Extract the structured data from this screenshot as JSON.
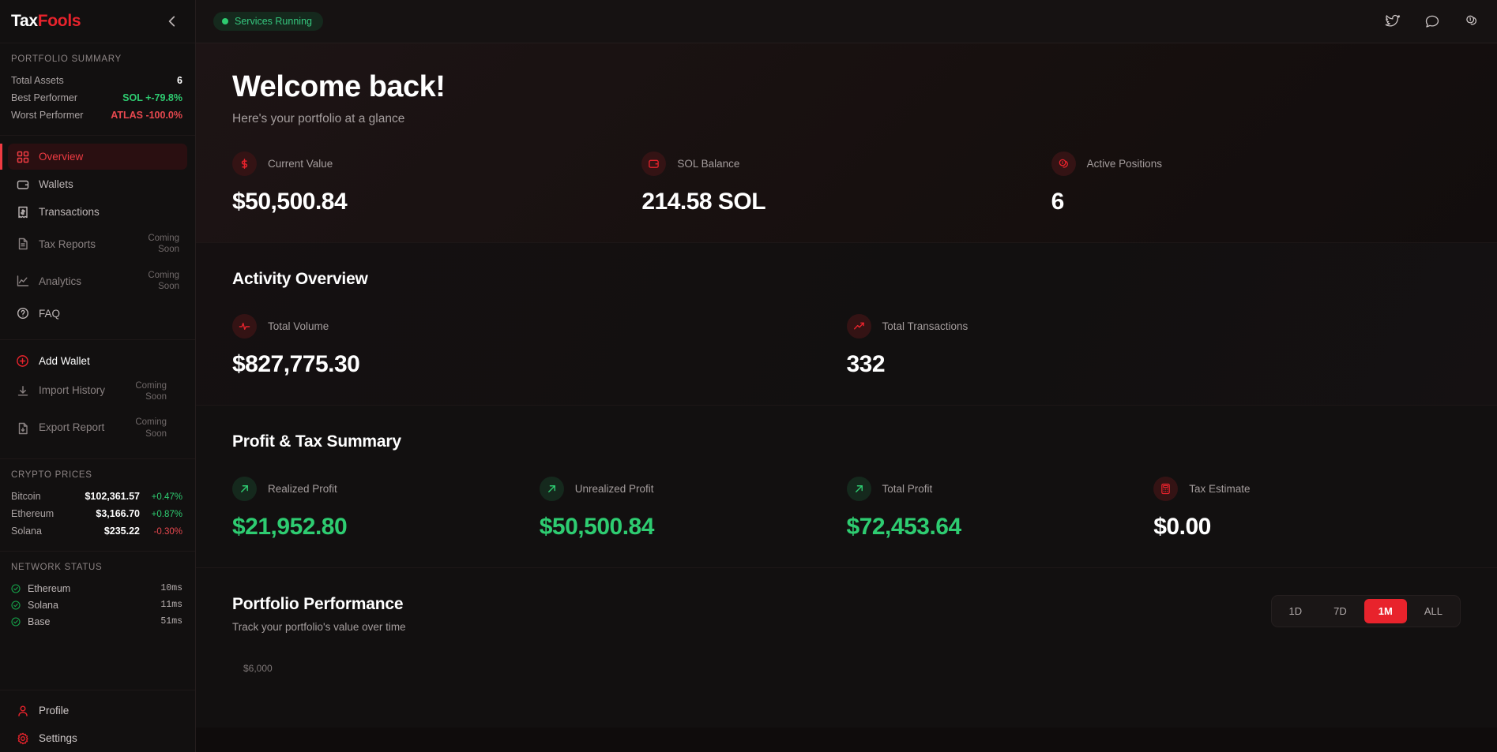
{
  "brand": {
    "part1": "Tax",
    "part2": "Fools",
    "collapse_icon": "chevron-left-icon"
  },
  "sidebar": {
    "portfolio_summary": {
      "title": "PORTFOLIO SUMMARY",
      "rows": [
        {
          "label": "Total Assets",
          "value": "6",
          "tone": "plain"
        },
        {
          "label": "Best Performer",
          "value": "SOL +-79.8%",
          "tone": "green"
        },
        {
          "label": "Worst Performer",
          "value": "ATLAS -100.0%",
          "tone": "red"
        }
      ]
    },
    "nav": [
      {
        "label": "Overview",
        "icon": "grid-icon",
        "badge": "",
        "active": true
      },
      {
        "label": "Wallets",
        "icon": "wallet-icon",
        "badge": "",
        "active": false
      },
      {
        "label": "Transactions",
        "icon": "receipt-icon",
        "badge": "",
        "active": false
      },
      {
        "label": "Tax Reports",
        "icon": "document-icon",
        "badge": "Coming Soon",
        "active": false
      },
      {
        "label": "Analytics",
        "icon": "chart-line-icon",
        "badge": "Coming Soon",
        "active": false
      },
      {
        "label": "FAQ",
        "icon": "question-circle-icon",
        "badge": "",
        "active": false
      }
    ],
    "actions": {
      "add_wallet": {
        "label": "Add Wallet",
        "icon": "plus-circle-icon"
      },
      "items": [
        {
          "label": "Import History",
          "icon": "download-icon",
          "badge": "Coming Soon"
        },
        {
          "label": "Export Report",
          "icon": "file-export-icon",
          "badge": "Coming Soon"
        }
      ]
    },
    "crypto_prices": {
      "title": "CRYPTO PRICES",
      "rows": [
        {
          "name": "Bitcoin",
          "price": "$102,361.57",
          "change": "+0.47%",
          "dir": "up"
        },
        {
          "name": "Ethereum",
          "price": "$3,166.70",
          "change": "+0.87%",
          "dir": "up"
        },
        {
          "name": "Solana",
          "price": "$235.22",
          "change": "-0.30%",
          "dir": "down"
        }
      ]
    },
    "network_status": {
      "title": "NETWORK STATUS",
      "rows": [
        {
          "name": "Ethereum",
          "latency": "10ms",
          "icon": "check-circle-icon"
        },
        {
          "name": "Solana",
          "latency": "11ms",
          "icon": "check-circle-icon"
        },
        {
          "name": "Base",
          "latency": "51ms",
          "icon": "check-circle-icon"
        }
      ]
    },
    "footer": [
      {
        "label": "Profile",
        "icon": "user-icon"
      },
      {
        "label": "Settings",
        "icon": "gear-icon"
      }
    ]
  },
  "topbar": {
    "status": {
      "label": "Services Running",
      "dot_color": "#2ecc71"
    },
    "icons": [
      {
        "name": "twitter-icon"
      },
      {
        "name": "chat-bubble-icon"
      },
      {
        "name": "coins-icon"
      }
    ]
  },
  "hero": {
    "title": "Welcome back!",
    "subtitle": "Here's your portfolio at a glance",
    "stats": [
      {
        "label": "Current Value",
        "value": "$50,500.84",
        "icon": "dollar-icon",
        "badge": "red",
        "tone": "white"
      },
      {
        "label": "SOL Balance",
        "value": "214.58 SOL",
        "icon": "wallet-icon",
        "badge": "red",
        "tone": "white"
      },
      {
        "label": "Active Positions",
        "value": "6",
        "icon": "positions-icon",
        "badge": "red",
        "tone": "white"
      }
    ]
  },
  "activity": {
    "title": "Activity Overview",
    "stats": [
      {
        "label": "Total Volume",
        "value": "$827,775.30",
        "icon": "pulse-icon",
        "badge": "red",
        "tone": "white"
      },
      {
        "label": "Total Transactions",
        "value": "332",
        "icon": "trending-up-icon",
        "badge": "red",
        "tone": "white"
      }
    ]
  },
  "profit": {
    "title": "Profit & Tax Summary",
    "stats": [
      {
        "label": "Realized Profit",
        "value": "$21,952.80",
        "icon": "arrow-up-right-icon",
        "badge": "green",
        "tone": "green"
      },
      {
        "label": "Unrealized Profit",
        "value": "$50,500.84",
        "icon": "arrow-up-right-icon",
        "badge": "green",
        "tone": "green"
      },
      {
        "label": "Total Profit",
        "value": "$72,453.64",
        "icon": "arrow-up-right-icon",
        "badge": "green",
        "tone": "green"
      },
      {
        "label": "Tax Estimate",
        "value": "$0.00",
        "icon": "calculator-icon",
        "badge": "red",
        "tone": "white"
      }
    ]
  },
  "performance": {
    "title": "Portfolio Performance",
    "subtitle": "Track your portfolio's value over time",
    "ranges": [
      {
        "label": "1D",
        "active": false
      },
      {
        "label": "7D",
        "active": false
      },
      {
        "label": "1M",
        "active": true
      },
      {
        "label": "ALL",
        "active": false
      }
    ],
    "y_tick_top": "$6,000"
  },
  "colors": {
    "accent": "#e8232c",
    "positive": "#2ecc71",
    "negative": "#e8484f",
    "sidebar_bg": "#121010",
    "main_bg": "#0f0c0c"
  }
}
